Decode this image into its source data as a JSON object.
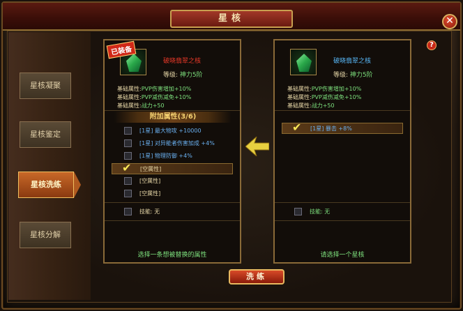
{
  "title": "星核",
  "side_tabs": [
    {
      "label": "星核凝聚"
    },
    {
      "label": "星核鉴定"
    },
    {
      "label": "星核洗练"
    },
    {
      "label": "星核分解"
    }
  ],
  "left_panel": {
    "equipped_tag": "已装备",
    "gem_name": "破晓翡翠之核",
    "level_key": "等级:",
    "level_value": "神力5阶",
    "base_attrs": [
      {
        "key": "基础属性:",
        "value": "PVP伤害增加+10%"
      },
      {
        "key": "基础属性:",
        "value": "PVP减伤减免+10%"
      },
      {
        "key": "基础属性:",
        "value": "战力+50"
      }
    ],
    "additional_header": "附加属性(3/6)",
    "rows": [
      {
        "text": "[1星] 最大物攻 +10000",
        "checked": false,
        "style": "blue"
      },
      {
        "text": "[1星] 对异能者伤害加成 +4%",
        "checked": false,
        "style": "blue"
      },
      {
        "text": "[1星] 物理防御 +4%",
        "checked": false,
        "style": "blue"
      },
      {
        "text": "[空属性]",
        "checked": true,
        "style": "cream"
      },
      {
        "text": "[空属性]",
        "checked": false,
        "style": "cream"
      },
      {
        "text": "[空属性]",
        "checked": false,
        "style": "cream"
      }
    ],
    "skill_key": "技能:",
    "skill_value": "无",
    "footer": "选择一条想被替换的属性"
  },
  "right_panel": {
    "gem_name": "破晓翡翠之核",
    "level_key": "等级:",
    "level_value": "神力5阶",
    "base_attrs": [
      {
        "key": "基础属性:",
        "value": "PVP伤害增加+10%"
      },
      {
        "key": "基础属性:",
        "value": "PVP减伤减免+10%"
      },
      {
        "key": "基础属性:",
        "value": "战力+50"
      }
    ],
    "rows": [
      {
        "text": "[1星] 暴击 +8%",
        "checked": true,
        "style": "blue"
      }
    ],
    "skill_key": "技能:",
    "skill_value": "无",
    "footer": "请选择一个星核"
  },
  "wash_button": "洗练",
  "colors": {
    "name_red": "#e83828",
    "name_blue": "#58b8f8"
  }
}
